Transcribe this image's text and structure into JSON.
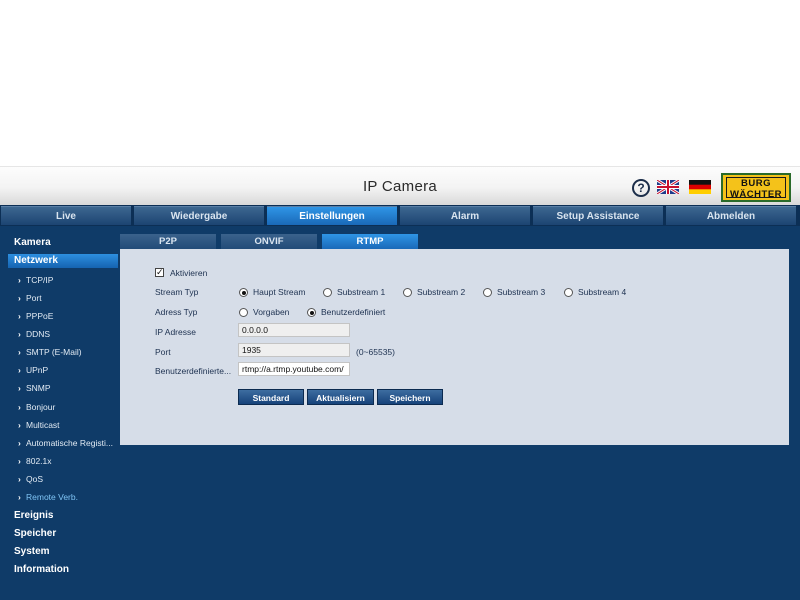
{
  "header": {
    "title": "IP Camera",
    "logo_top": "BURG",
    "logo_bottom": "WÄCHTER"
  },
  "nav": [
    "Live",
    "Wiedergabe",
    "Einstellungen",
    "Alarm",
    "Setup Assistance",
    "Abmelden"
  ],
  "sidebar": {
    "camera": "Kamera",
    "network": "Netzwerk",
    "items": [
      "TCP/IP",
      "Port",
      "PPPoE",
      "DDNS",
      "SMTP (E-Mail)",
      "UPnP",
      "SNMP",
      "Bonjour",
      "Multicast",
      "Automatische Registi...",
      "802.1x",
      "QoS",
      "Remote Verb."
    ],
    "event": "Ereignis",
    "storage": "Speicher",
    "system": "System",
    "information": "Information"
  },
  "subtabs": [
    "P2P",
    "ONVIF",
    "RTMP"
  ],
  "form": {
    "enable_label": "Aktivieren",
    "stream_type_label": "Stream Typ",
    "streams": [
      "Haupt Stream",
      "Substream 1",
      "Substream 2",
      "Substream 3",
      "Substream 4"
    ],
    "address_type_label": "Adress Typ",
    "address_types": [
      "Vorgaben",
      "Benutzerdefiniert"
    ],
    "ip_label": "IP Adresse",
    "ip_value": "0.0.0.0",
    "port_label": "Port",
    "port_value": "1935",
    "port_range": "(0~65535)",
    "custom_label": "Benutzerdefinierte...",
    "custom_value": "rtmp://a.rtmp.youtube.com/",
    "buttons": [
      "Standard",
      "Aktualisiern",
      "Speichern"
    ]
  },
  "colors": {
    "navy": "#0f3b68",
    "active_blue": "#1f7fd6",
    "panel": "#d6dde8"
  }
}
